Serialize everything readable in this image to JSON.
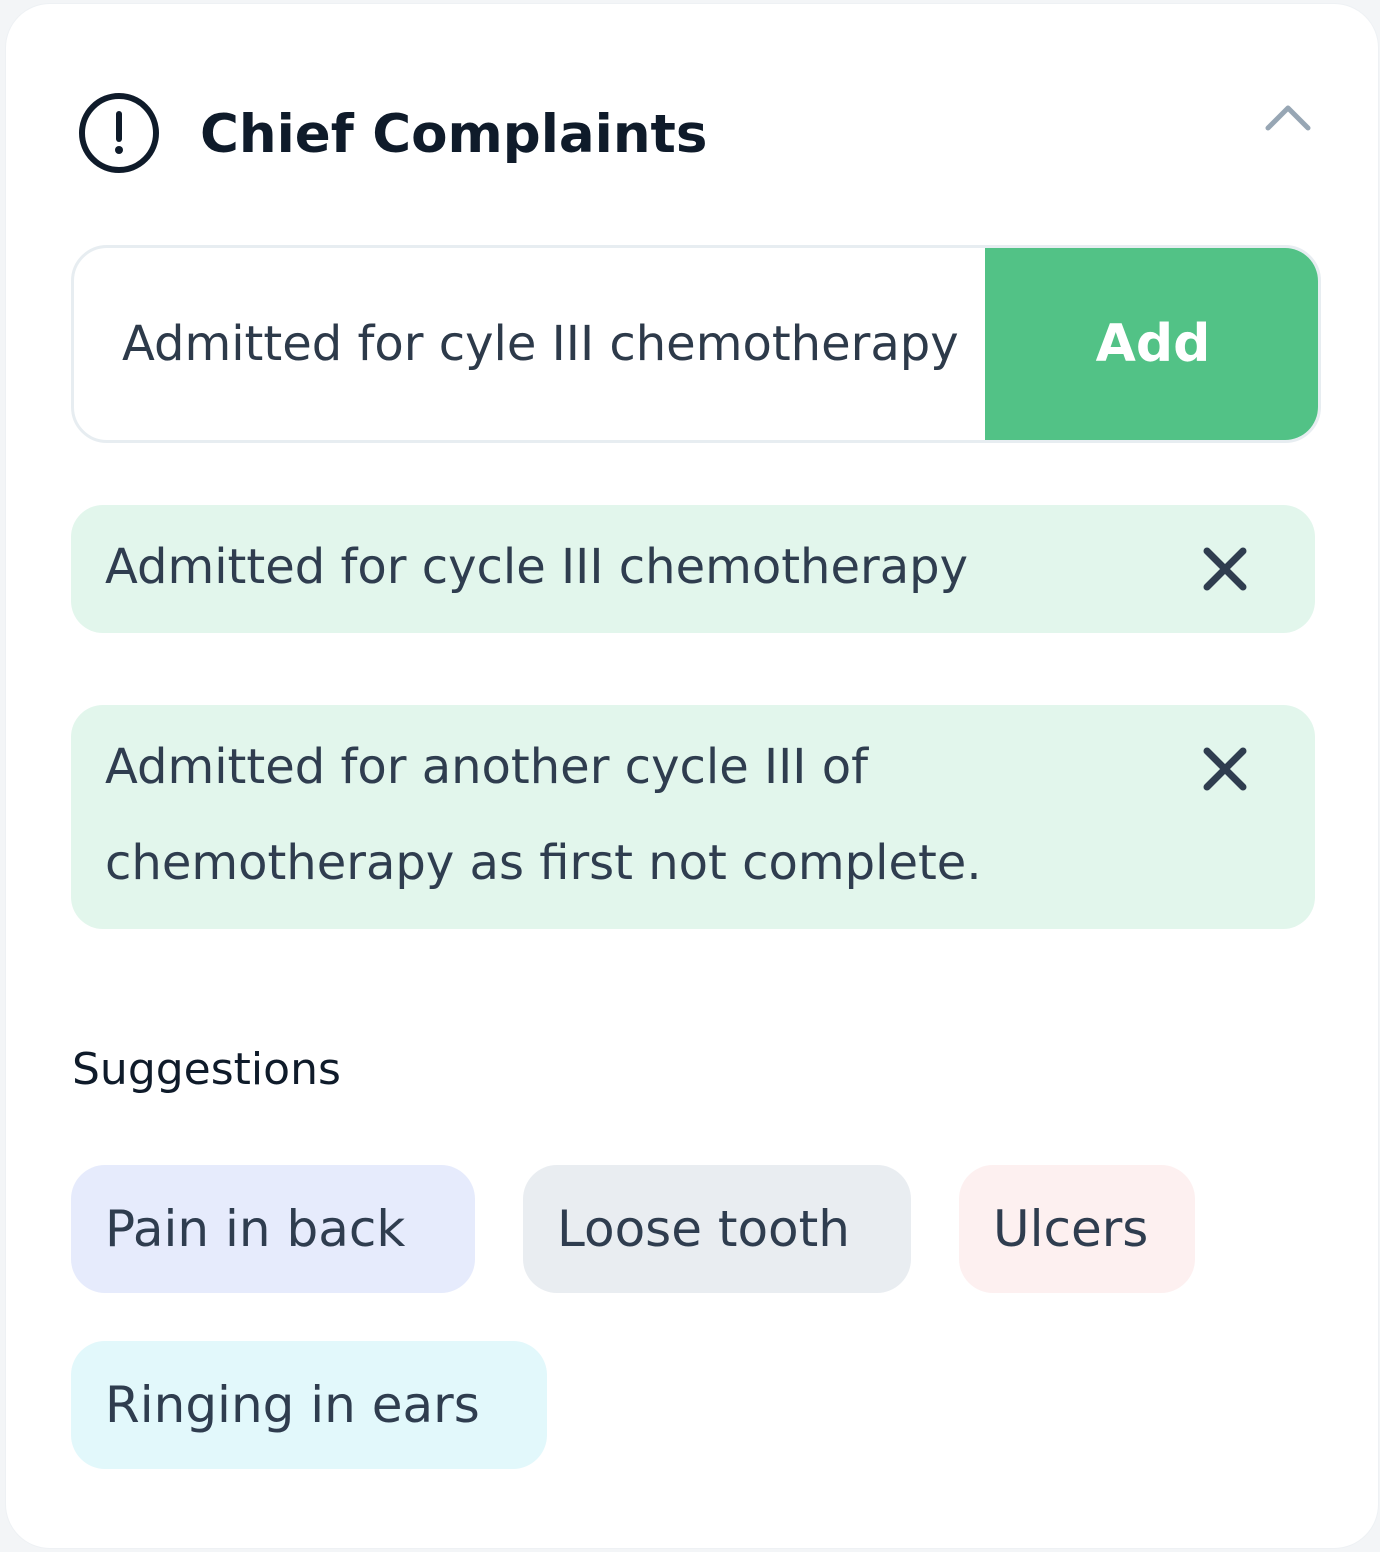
{
  "header": {
    "title": "Chief Complaints",
    "icon": "alert-circle-icon",
    "collapse_icon": "chevron-up-icon"
  },
  "input": {
    "value": "Admitted for cyle III chemotherapy",
    "add_label": "Add"
  },
  "complaints": [
    {
      "text": "Admitted for cycle III chemotherapy",
      "remove_icon": "close-icon"
    },
    {
      "text": "Admitted for another cycle III of chemotherapy as first not complete.",
      "remove_icon": "close-icon"
    }
  ],
  "suggestions": {
    "heading": "Suggestions",
    "items": [
      {
        "label": "Pain in back",
        "color": "#e6ebfc"
      },
      {
        "label": "Loose tooth",
        "color": "#e9edf1"
      },
      {
        "label": "Ulcers",
        "color": "#fdf0f0"
      },
      {
        "label": "Ringing in ears",
        "color": "#e2f8fb"
      }
    ]
  },
  "colors": {
    "accent": "#52c286",
    "complaint_bg": "#e2f6ec",
    "text_dark": "#0f1b2a",
    "text_body": "#2f3d4f"
  }
}
